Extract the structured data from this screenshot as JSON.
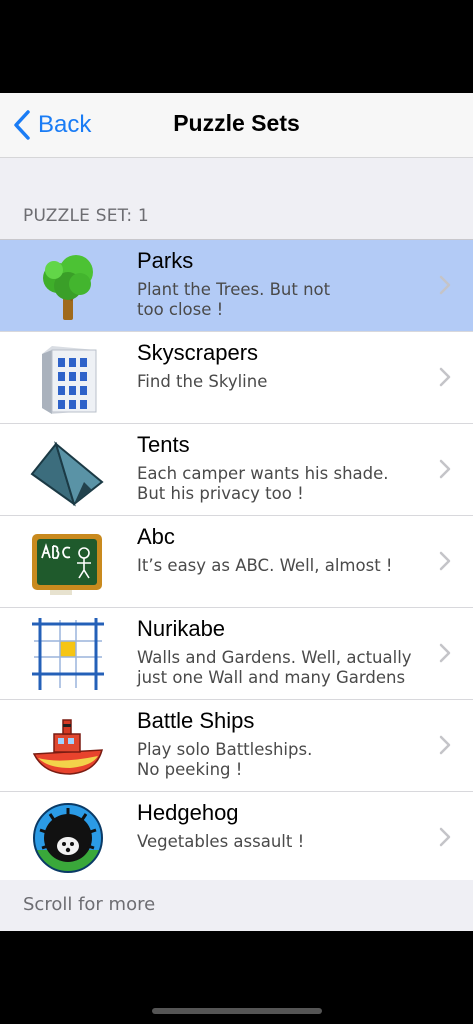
{
  "navbar": {
    "back_label": "Back",
    "title": "Puzzle Sets"
  },
  "section_header": "PUZZLE SET: 1",
  "items": [
    {
      "name": "Parks",
      "description": "Plant the Trees. But not\ntoo close !",
      "icon": "tree-icon",
      "selected": true
    },
    {
      "name": "Skyscrapers",
      "description": "Find the Skyline",
      "icon": "building-icon",
      "selected": false
    },
    {
      "name": "Tents",
      "description": "Each camper wants his shade.\nBut his privacy too !",
      "icon": "tent-icon",
      "selected": false
    },
    {
      "name": "Abc",
      "description": "It’s easy as ABC. Well, almost !",
      "icon": "chalkboard-icon",
      "selected": false
    },
    {
      "name": "Nurikabe",
      "description": "Walls and Gardens. Well, actually\njust one Wall and many Gardens",
      "icon": "grid-icon",
      "selected": false
    },
    {
      "name": "Battle Ships",
      "description": "Play solo Battleships.\nNo peeking !",
      "icon": "boat-icon",
      "selected": false
    },
    {
      "name": "Hedgehog",
      "description": "Vegetables assault !",
      "icon": "hedgehog-icon",
      "selected": false
    }
  ],
  "footer": "Scroll for more",
  "colors": {
    "accent": "#1a7cf5",
    "selected_row": "#b3cbf6",
    "background": "#efeff4"
  }
}
